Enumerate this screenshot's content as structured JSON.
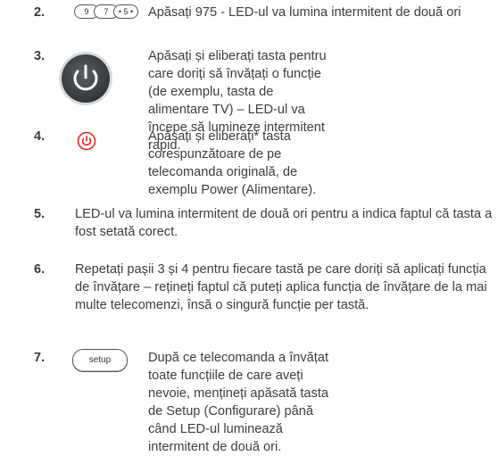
{
  "steps": [
    {
      "num": "2.",
      "keys": [
        "9",
        "7",
        "5"
      ],
      "text": "Apăsați 975 - LED-ul va lumina intermitent de două ori"
    },
    {
      "num": "3.",
      "text": "Apăsați și eliberați tasta pentru care doriți să învățați o funcție (de exemplu, tasta de alimentare TV) – LED-ul va începe să lumineze intermitent rapid."
    },
    {
      "num": "4.",
      "text": "Apăsați și eliberați* tasta corespunzătoare de pe telecomanda originală, de exemplu Power (Alimentare)."
    },
    {
      "num": "5.",
      "text": "LED-ul va lumina intermitent de două ori pentru a indica faptul că tasta a fost setată corect."
    },
    {
      "num": "6.",
      "text": "Repetați pașii 3 și 4 pentru fiecare tastă pe care doriți să aplicați funcția de învățare – rețineți faptul că puteți aplica funcția de învățare de la mai multe telecomenzi, însă o singură funcție per tastă."
    },
    {
      "num": "7.",
      "key_label": "setup",
      "text": "După ce telecomanda a învățat toate funcțiile de care aveți nevoie, mențineți apăsată tasta de Setup (Configurare) până când LED-ul luminează intermitent de două ori."
    }
  ],
  "colors": {
    "power_red": "#e2231a",
    "button_dark": "#3f4347"
  },
  "icons": {
    "step3": "power-button-icon",
    "step4": "power-icon"
  }
}
